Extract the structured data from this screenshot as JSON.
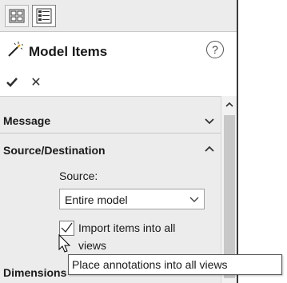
{
  "tabs": [
    {
      "name": "property-manager-tab",
      "icon": "property-manager-icon"
    },
    {
      "name": "feature-manager-tab",
      "icon": "feature-list-icon"
    }
  ],
  "header": {
    "icon": "model-items-wand-icon",
    "title": "Model Items",
    "help_glyph": "?"
  },
  "actions": {
    "ok_icon": "checkmark-icon",
    "cancel_glyph": "✕"
  },
  "sections": {
    "message": {
      "title": "Message"
    },
    "source_destination": {
      "title": "Source/Destination",
      "source_label": "Source:",
      "source_select": {
        "value": "Entire model"
      },
      "import_checkbox": {
        "label": "Import items into all views",
        "checked": true
      }
    },
    "dimensions": {
      "title": "Dimensions"
    }
  },
  "tooltip": {
    "text": "Place annotations into all views"
  },
  "colors": {
    "panel_bg": "#ececec",
    "tab_bg": "#ececec",
    "ok_green": "#2e2e2e",
    "border": "#a0a0a0"
  }
}
